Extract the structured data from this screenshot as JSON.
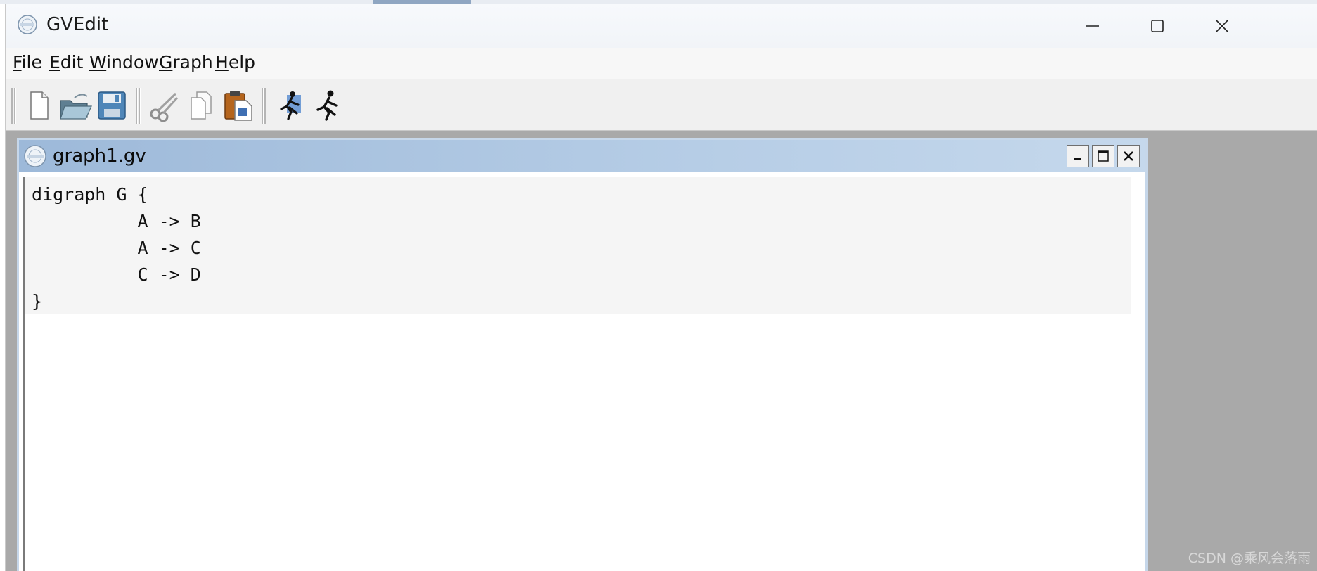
{
  "app": {
    "title": "GVEdit"
  },
  "window_controls": {
    "minimize": "minimize-icon",
    "maximize": "maximize-icon",
    "close": "close-icon"
  },
  "menu": {
    "items": [
      {
        "label": "File"
      },
      {
        "label": "Edit"
      },
      {
        "label": "Window"
      },
      {
        "label": "Graph"
      },
      {
        "label": "Help"
      }
    ]
  },
  "toolbar": {
    "icons": [
      "new-file-icon",
      "open-folder-icon",
      "save-disk-icon",
      "cut-scissors-icon",
      "copy-icon",
      "paste-icon",
      "layout-settings-runner-icon",
      "run-layout-runner-icon"
    ]
  },
  "document": {
    "title": "graph1.gv",
    "lines": [
      "digraph G {",
      "          A -> B",
      "          A -> C",
      "          C -> D",
      "}"
    ]
  },
  "watermark": "CSDN @乘风会落雨",
  "colors": {
    "child_titlebar": "#9db9d9",
    "mdi_background": "#a9a9a9",
    "editor_text_bg": "#f5f5f5"
  }
}
